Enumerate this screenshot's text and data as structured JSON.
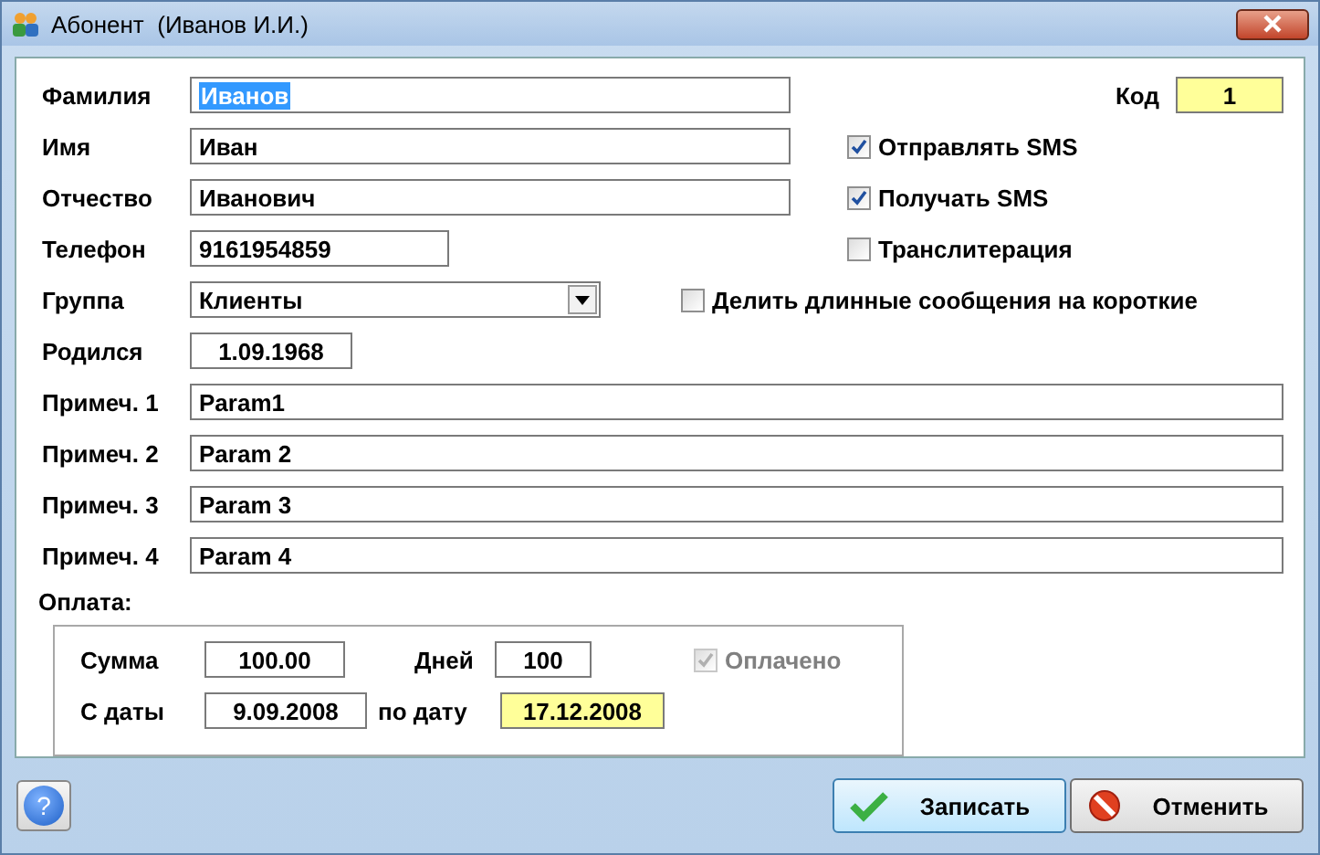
{
  "window": {
    "title": "Абонент  (Иванов И.И.)"
  },
  "fields": {
    "surname": {
      "label": "Фамилия",
      "value": "Иванов",
      "selected": true
    },
    "name": {
      "label": "Имя",
      "value": "Иван"
    },
    "patronymic": {
      "label": "Отчество",
      "value": "Иванович"
    },
    "phone": {
      "label": "Телефон",
      "value": "9161954859"
    },
    "group": {
      "label": "Группа",
      "value": "Клиенты"
    },
    "born": {
      "label": "Родился",
      "value": "1.09.1968"
    }
  },
  "code": {
    "label": "Код",
    "value": "1"
  },
  "checkboxes": [
    {
      "label": "Отправлять SMS",
      "checked": true
    },
    {
      "label": "Получать SMS",
      "checked": true
    },
    {
      "label": "Транслитерация",
      "checked": false
    },
    {
      "label": "Делить длинные сообщения на короткие",
      "checked": false
    }
  ],
  "notes": [
    {
      "label": "Примеч. 1",
      "value": "Param1"
    },
    {
      "label": "Примеч. 2",
      "value": "Param 2"
    },
    {
      "label": "Примеч. 3",
      "value": "Param 3"
    },
    {
      "label": "Примеч. 4",
      "value": "Param 4"
    }
  ],
  "payment": {
    "title": "Оплата:",
    "sum_label": "Сумма",
    "sum": "100.00",
    "days_label": "Дней",
    "days": "100",
    "paid": {
      "label": "Оплачено",
      "checked": true,
      "disabled": true
    },
    "from_label": "С даты",
    "from": "9.09.2008",
    "to_label": "по дату",
    "to": "17.12.2008"
  },
  "help_button": {
    "label": "?"
  },
  "buttons": [
    {
      "label": "Записать",
      "kind": "save"
    },
    {
      "label": "Отменить",
      "kind": "cancel"
    }
  ]
}
